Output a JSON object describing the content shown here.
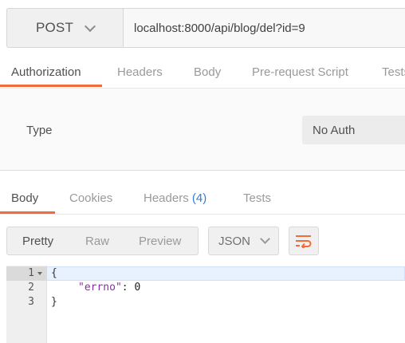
{
  "request": {
    "method": "POST",
    "url": "localhost:8000/api/blog/del?id=9"
  },
  "request_tabs": [
    {
      "label": "Authorization",
      "active": true
    },
    {
      "label": "Headers",
      "active": false
    },
    {
      "label": "Body",
      "active": false
    },
    {
      "label": "Pre-request Script",
      "active": false
    },
    {
      "label": "Tests",
      "active": false
    }
  ],
  "auth": {
    "type_label": "Type",
    "type_value": "No Auth"
  },
  "response_tabs": [
    {
      "label": "Body",
      "active": true
    },
    {
      "label": "Cookies",
      "active": false
    },
    {
      "label": "Headers",
      "count": "(4)",
      "active": false
    },
    {
      "label": "Tests",
      "active": false
    }
  ],
  "view": {
    "modes": [
      {
        "label": "Pretty",
        "active": true
      },
      {
        "label": "Raw",
        "active": false
      },
      {
        "label": "Preview",
        "active": false
      }
    ],
    "format": "JSON",
    "wrap_icon": "wrap-lines-icon"
  },
  "code": {
    "line_numbers": [
      "1",
      "2",
      "3"
    ],
    "open_brace": "{",
    "key": "\"errno\"",
    "separator": ": ",
    "value": "0",
    "close_brace": "}"
  },
  "colors": {
    "accent": "#f26b3a",
    "count": "#2f7fd6",
    "json_key": "#8a2ea0"
  }
}
